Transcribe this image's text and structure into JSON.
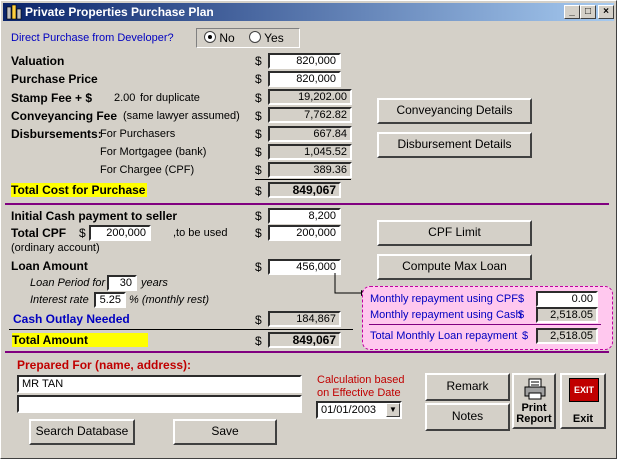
{
  "window": {
    "title": "Private Properties Purchase Plan",
    "minimize": "_",
    "maximize": "□",
    "close": "×"
  },
  "direct": {
    "label": "Direct Purchase from Developer?",
    "no": "No",
    "yes": "Yes",
    "selected": "No"
  },
  "currency": "$",
  "valuation": {
    "label": "Valuation",
    "value": "820,000"
  },
  "price": {
    "label": "Purchase Price",
    "value": "820,000"
  },
  "stamp": {
    "label": "Stamp Fee + $",
    "dup_amount": "2.00",
    "dup_label": "for duplicate",
    "value": "19,202.00"
  },
  "conveyancing": {
    "label": "Conveyancing Fee",
    "note": "(same lawyer assumed)",
    "value": "7,762.82"
  },
  "disb": {
    "label": "Disbursements:",
    "purchasers_label": "For Purchasers",
    "purchasers": "667.84",
    "mortgagee_label": "For Mortgagee (bank)",
    "mortgagee": "1,045.52",
    "chargee_label": "For Chargee (CPF)",
    "chargee": "389.36"
  },
  "total_cost": {
    "label": "Total Cost for Purchase",
    "value": "849,067"
  },
  "cash_payment": {
    "label": "Initial Cash payment to seller",
    "value": "8,200"
  },
  "cpf": {
    "label": "Total CPF",
    "value": "200,000",
    "to_be_used": ",to be used",
    "used": "200,000",
    "sub": "(ordinary account)"
  },
  "loan": {
    "label": "Loan Amount",
    "value": "456,000",
    "period_label": "Loan Period for",
    "period": "30",
    "period_unit": "years",
    "rate_label": "Interest rate",
    "rate": "5.25",
    "rate_unit": "% (monthly rest)"
  },
  "cash_outlay": {
    "label": "Cash Outlay Needed",
    "value": "184,867"
  },
  "total_amount": {
    "label": "Total Amount",
    "value": "849,067"
  },
  "buttons": {
    "conveyancing": "Conveyancing Details",
    "disbursement": "Disbursement Details",
    "cpf_limit": "CPF Limit",
    "compute": "Compute Max Loan",
    "remark": "Remark",
    "notes": "Notes",
    "print": "Print Report",
    "exit": "Exit",
    "exit_icon_text": "EXIT",
    "search": "Search Database",
    "save": "Save"
  },
  "repay": {
    "cpf_label": "Monthly repayment using CPF",
    "cpf": "0.00",
    "cash_label": "Monthly repayment using Cash",
    "cash": "2,518.05",
    "total_label": "Total Monthly Loan repayment",
    "total": "2,518.05"
  },
  "prepared": {
    "label": "Prepared For (name, address):",
    "line1": "MR TAN",
    "line2": ""
  },
  "calc": {
    "label1": "Calculation based",
    "label2": "on Effective Date",
    "date": "01/01/2003"
  }
}
